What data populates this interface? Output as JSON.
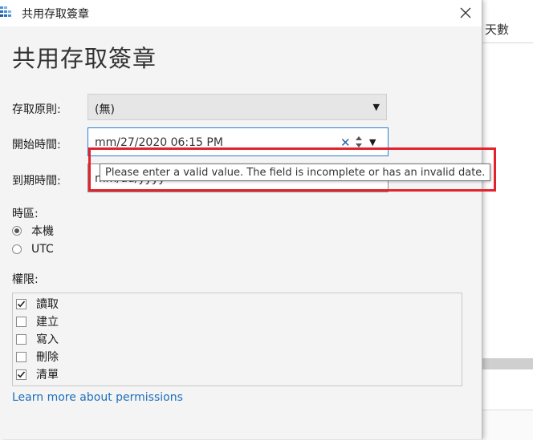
{
  "background": {
    "header_text": "天數"
  },
  "dialog": {
    "window_title": "共用存取簽章",
    "page_title": "共用存取簽章"
  },
  "form": {
    "access_policy_label": "存取原則:",
    "access_policy_value": "(無)",
    "start_time_label": "開始時間:",
    "start_time_value": "mm/27/2020 06:15 PM",
    "expiry_time_label": "到期時間:",
    "expiry_time_value": "mm/dd/yyyy",
    "timezone_label": "時區:",
    "timezone_options": [
      {
        "label": "本機",
        "selected": true
      },
      {
        "label": "UTC",
        "selected": false
      }
    ],
    "permissions_label": "權限:",
    "permissions": [
      {
        "label": "讀取",
        "checked": true
      },
      {
        "label": "建立",
        "checked": false
      },
      {
        "label": "寫入",
        "checked": false
      },
      {
        "label": "刪除",
        "checked": false
      },
      {
        "label": "清單",
        "checked": true
      }
    ],
    "learn_more_link": "Learn more about permissions"
  },
  "tooltip": {
    "text": "Please enter a valid value. The field is incomplete or has an invalid date."
  },
  "colors": {
    "accent": "#2a7fd4",
    "highlight": "#e3232b",
    "link": "#1e6fba"
  }
}
